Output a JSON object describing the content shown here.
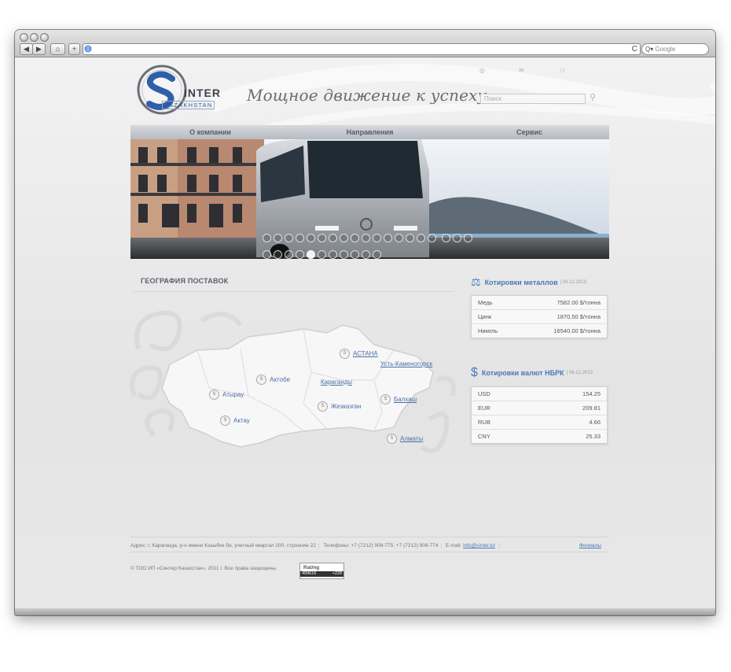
{
  "browser": {
    "search_placeholder": "Google",
    "search_icon_text": "Q▾",
    "nav_back": "◀",
    "nav_forward": "▶",
    "home": "⌂",
    "add": "+",
    "reload": "C"
  },
  "header": {
    "logo_text": "INTER",
    "logo_sub": "KAZAKHSTAN",
    "slogan": "Мощное движение к успеху",
    "search_placeholder": "Поиск"
  },
  "menu": {
    "items": [
      "О компании",
      "Направления",
      "Сервис"
    ]
  },
  "geography": {
    "title": "ГЕОГРАФИЯ ПОСТАВОК",
    "cities": [
      "АСТАНА",
      "Усть-Каменогорск",
      "Актобе",
      "Караганды",
      "Атырау",
      "Жезказган",
      "Балхаш",
      "Актау",
      "Алматы"
    ]
  },
  "metals": {
    "title": "Котировки металлов",
    "date": "06.12.2013",
    "rows": [
      {
        "name": "Медь",
        "value": "7582.00 $/тонна"
      },
      {
        "name": "Цинк",
        "value": "1870.50 $/тонна"
      },
      {
        "name": "Никель",
        "value": "16540.00 $/тонна"
      }
    ]
  },
  "currency": {
    "title": "Котировки валют НБРК",
    "date": "06.12.2013",
    "rows": [
      {
        "name": "USD",
        "value": "154.25"
      },
      {
        "name": "EUR",
        "value": "209.81"
      },
      {
        "name": "RUB",
        "value": "4.66"
      },
      {
        "name": "CNY",
        "value": "25.33"
      }
    ]
  },
  "footer": {
    "address": "Адрес: г. Караганда, р-н имени Казыбек би, учетный квартал 200, строение 22",
    "phones": "Телефоны: +7 (7212) 908-775; +7 (7212) 908-774",
    "email_label": "E-mail:",
    "email": "info@sinter.kz",
    "branches": "Филиалы",
    "copyright": "© ТОО ИП «Синтер Казахстан», 2011 г. Все права защищены.",
    "counter_top": "Rat/ng",
    "counter_left": "499616",
    "counter_right": "+228"
  },
  "colors": {
    "accent": "#4a78b5",
    "menu_bg": "#c4c8ce",
    "page_bg": "#e9e9ea"
  }
}
